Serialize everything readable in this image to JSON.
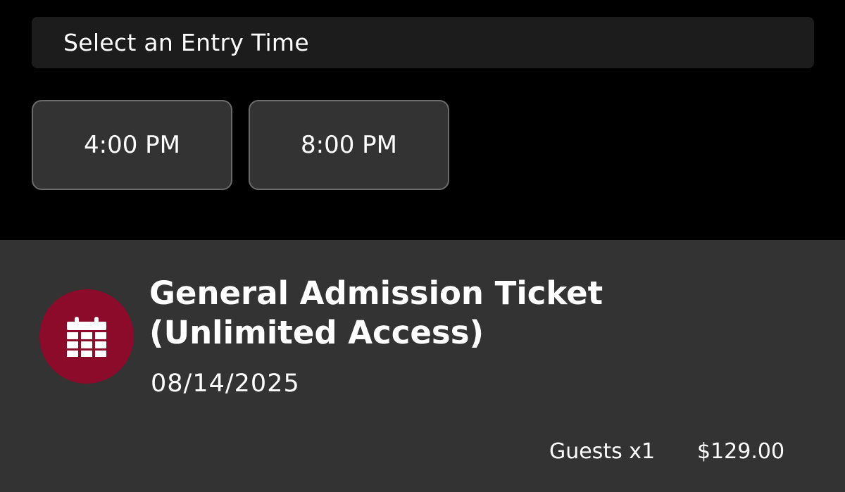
{
  "entry_time": {
    "heading": "Select an Entry Time",
    "options": [
      "4:00 PM",
      "8:00 PM"
    ]
  },
  "ticket": {
    "icon": "calendar-icon",
    "title_line1": "General Admission Ticket",
    "title_line2": "(Unlimited Access)",
    "date": "08/14/2025",
    "guests": "Guests x1",
    "price": "$129.00"
  },
  "colors": {
    "accent": "#8c0a2a",
    "card_background": "#333333",
    "page_background": "#000000",
    "button_border": "#6b6b6b"
  }
}
